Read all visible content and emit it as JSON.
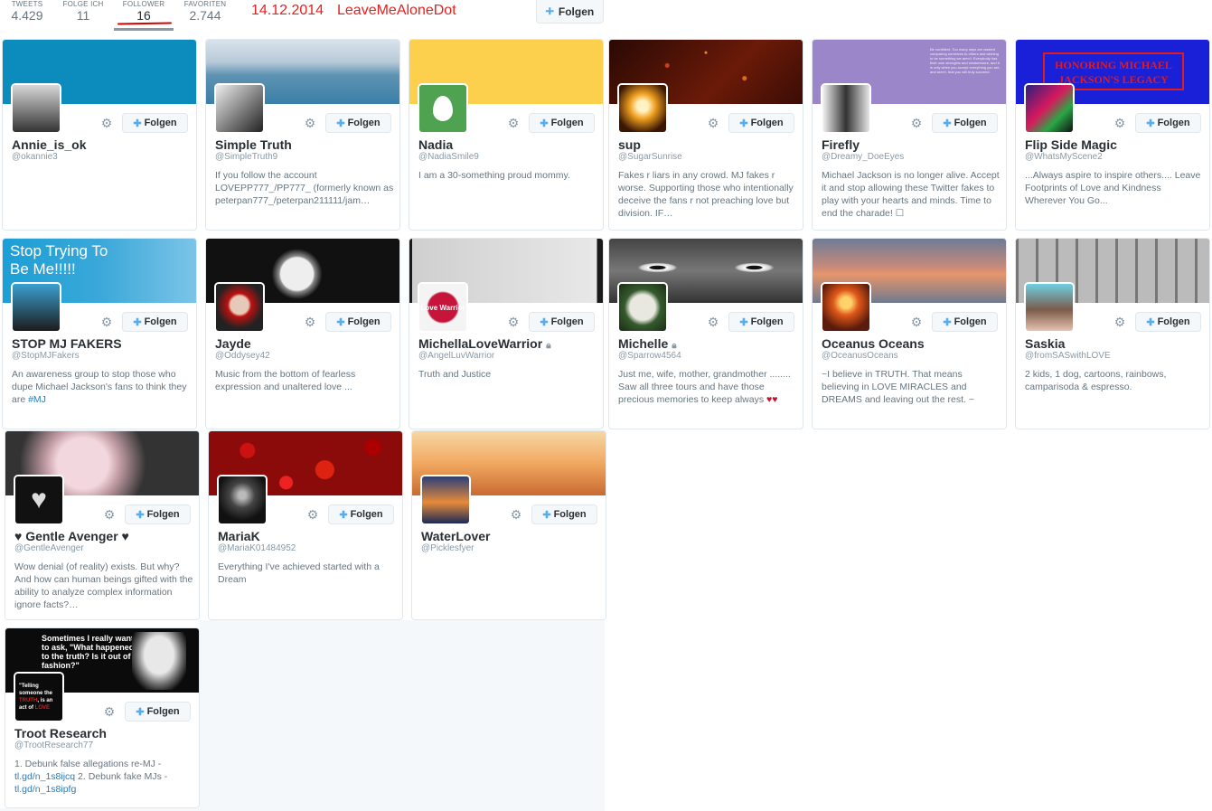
{
  "stats": [
    {
      "label": "TWEETS",
      "value": "4.429"
    },
    {
      "label": "FOLGE ICH",
      "value": "11"
    },
    {
      "label": "FOLLOWER",
      "value": "16"
    },
    {
      "label": "FAVORITEN",
      "value": "2.744"
    }
  ],
  "annotation": {
    "date": "14.12.2014",
    "account": "LeaveMeAloneDot"
  },
  "follow_label": "Folgen",
  "banner_texts": {
    "stop_trying": "Stop Trying To Be Me!!!!!",
    "legacy": "HONORING MICHAEL JACKSON'S LEGACY",
    "purple_quote": "Be confident. Too many days are wasted comparing ourselves to others and wishing to be something we aren't. Everybody has their own strengths and weaknesses, and it is only when you accept everything you are, and aren't, that you will truly succeed.",
    "troot_quote": "Sometimes I really want to ask, \"What happened to the truth? Is it out of fashion?\"",
    "troot_avatar_1": "\"Telling someone the ",
    "troot_avatar_2": "TRUTH",
    "troot_avatar_3": ", is an act of ",
    "troot_avatar_4": "LOVE",
    "love_warrior": "Love Warrior"
  },
  "cards": [
    {
      "name": "Annie_is_ok",
      "handle": "@okannie3",
      "bio": ""
    },
    {
      "name": "Simple Truth",
      "handle": "@SimpleTruth9",
      "bio": "If you follow the account LOVEPP777_/PP777_ (formerly known as peterpan777_/peterpan211111/jam…"
    },
    {
      "name": "Nadia",
      "handle": "@NadiaSmile9",
      "bio": "I am a 30-something proud mommy."
    },
    {
      "name": "sup",
      "handle": "@SugarSunrise",
      "bio": "Fakes r liars in any crowd. MJ fakes r worse. Supporting those who intentionally deceive the fans r not preaching love but division. IF…"
    },
    {
      "name": "Firefly",
      "handle": "@Dreamy_DoeEyes",
      "bio": "Michael Jackson is no longer alive. Accept it and stop allowing these Twitter fakes to play with your hearts and minds. Time to end the charade! ☐"
    },
    {
      "name": "Flip Side Magic",
      "handle": "@WhatsMyScene2",
      "bio": "...Always aspire to inspire others.... Leave Footprints of Love and Kindness Wherever You Go..."
    },
    {
      "name": "STOP MJ FAKERS",
      "handle": "@StopMJFakers",
      "bio": "An awareness group to stop those who dupe Michael Jackson's fans to think they are ",
      "bio_link": "#MJ"
    },
    {
      "name": "Jayde",
      "handle": "@Oddysey42",
      "bio": "Music from the bottom of fearless expression and unaltered love ..."
    },
    {
      "name": "MichellaLoveWarrior",
      "handle": "@AngelLuvWarrior",
      "bio": "Truth and Justice"
    },
    {
      "name": "Michelle",
      "handle": "@Sparrow4564",
      "bio": "Just me, wife, mother, grandmother ........ Saw all three tours and have those precious memories to keep always ",
      "hearts": "♥♥"
    },
    {
      "name": "Oceanus Oceans",
      "handle": "@OceanusOceans",
      "bio": "~I believe in TRUTH. That means believing in LOVE MIRACLES and DREAMS and leaving out the rest. ~"
    },
    {
      "name": "Saskia",
      "handle": "@fromSASwithLOVE",
      "bio": "2 kids, 1 dog, cartoons, rainbows, camparisoda & espresso."
    },
    {
      "name": "♥ Gentle Avenger ♥",
      "handle": "@GentleAvenger",
      "bio": "Wow denial (of reality) exists. But why? And how can human beings gifted with the ability to analyze complex information ignore facts?…"
    },
    {
      "name": "MariaK",
      "handle": "@MariaK01484952",
      "bio": "Everything I've achieved started with a Dream"
    },
    {
      "name": "WaterLover",
      "handle": "@Picklesfyer",
      "bio": ""
    },
    {
      "name": "Troot Research",
      "handle": "@TrootResearch77",
      "bio": "1. Debunk false allegations re-MJ - ",
      "bio_link": "tl.gd/n_1s8ijcq",
      "bio2": " 2. Debunk fake MJs - ",
      "bio_link2": "tl.gd/n_1s8ipfg"
    }
  ]
}
